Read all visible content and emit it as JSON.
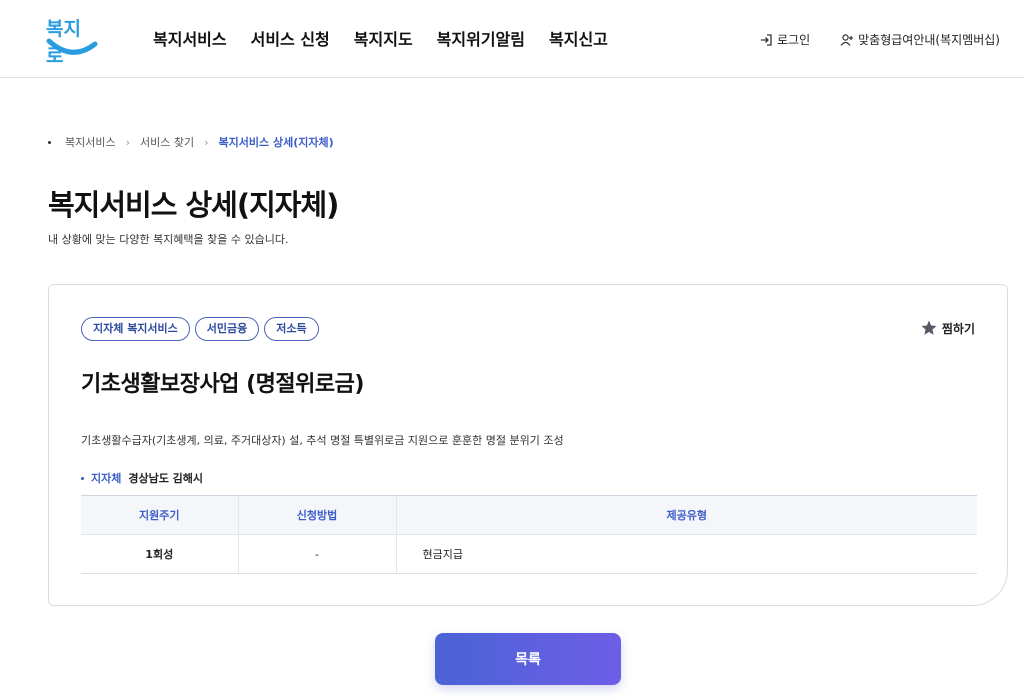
{
  "header": {
    "logo_alt": "복지로",
    "logo_text": "복지로",
    "nav": [
      "복지서비스",
      "서비스 신청",
      "복지지도",
      "복지위기알림",
      "복지신고"
    ],
    "login_label": "로그인",
    "membership_label": "맞춤형급여안내(복지멤버십)"
  },
  "breadcrumb": {
    "items": [
      "복지서비스",
      "서비스 찾기"
    ],
    "current": "복지서비스 상세(지자체)"
  },
  "page": {
    "title": "복지서비스 상세(지자체)",
    "description": "내 상황에 맞는 다양한 복지혜택을 찾을 수 있습니다."
  },
  "service": {
    "tags": [
      "지자체 복지서비스",
      "서민금융",
      "저소득"
    ],
    "favorite_label": "찜하기",
    "title": "기초생활보장사업 (명절위로금)",
    "description": "기초생활수급자(기초생계, 의료, 주거대상자) 설, 추석 명절 특별위로금 지원으로 훈훈한 명절 분위기 조성",
    "agency_label": "지자체",
    "agency_value": "경상남도 김해시",
    "table": {
      "headers": [
        "지원주기",
        "신청방법",
        "제공유형"
      ],
      "row": [
        "1회성",
        "-",
        "현금지급"
      ]
    }
  },
  "list_button_label": "목록",
  "colors": {
    "accent": "#3d5ec8",
    "button_start": "#4a63d6",
    "button_end": "#6e5ee6"
  }
}
